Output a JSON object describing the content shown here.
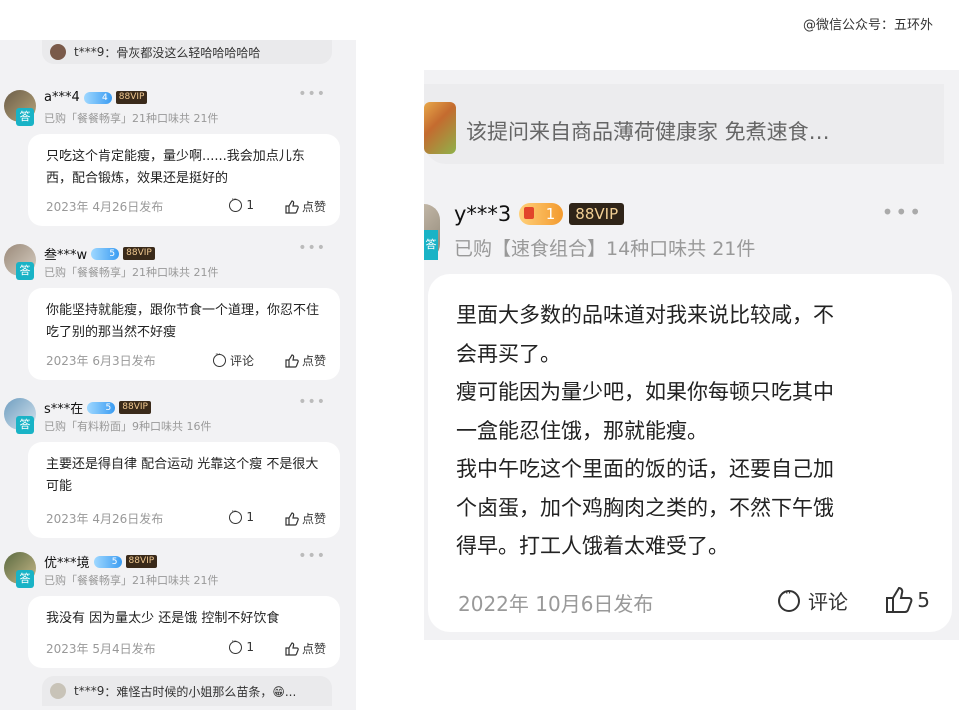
{
  "watermark": "@微信公众号：五环外",
  "left": {
    "top_reply": {
      "user": "t***9",
      "text": "骨灰都没这么轻哈哈哈哈哈"
    },
    "reviews": [
      {
        "user": "a***4",
        "level": "4",
        "vip": "88VIP",
        "answer_badge": "答",
        "bought": "已购「餐餐畅享」21种口味共 21件",
        "text": "只吃这个肯定能瘦，量少啊......我会加点儿东西，配合锻炼，效果还是挺好的",
        "date": "2023年 4月26日发布",
        "comment": "1",
        "like": "点赞"
      },
      {
        "user": "叁***w",
        "level": "5",
        "vip": "88VIP",
        "answer_badge": "答",
        "bought": "已购「餐餐畅享」21种口味共 21件",
        "text": "你能坚持就能瘦，跟你节食一个道理，你忍不住吃了别的那当然不好瘦",
        "date": "2023年 6月3日发布",
        "comment": "评论",
        "like": "点赞"
      },
      {
        "user": "s***在",
        "level": "5",
        "vip": "88VIP",
        "answer_badge": "答",
        "bought": "已购「有料粉面」9种口味共 16件",
        "text": "主要还是得自律 配合运动 光靠这个瘦 不是很大可能",
        "date": "2023年 4月26日发布",
        "comment": "1",
        "like": "点赞"
      },
      {
        "user": "优***境",
        "level": "5",
        "vip": "88VIP",
        "answer_badge": "答",
        "bought": "已购「餐餐畅享」21种口味共 21件",
        "text": "我没有 因为量太少 还是饿 控制不好饮食",
        "date": "2023年 5月4日发布",
        "comment": "1",
        "like": "点赞"
      }
    ],
    "bottom_reply": {
      "user": "t***9",
      "text": "难怪古时候的小姐那么苗条，😁..."
    }
  },
  "right": {
    "from_text": "该提问来自商品薄荷健康家 免煮速食…",
    "review": {
      "user": "y***3",
      "level": "1",
      "vip": "88VIP",
      "answer_badge": "答",
      "bought": "已购【速食组合】14种口味共 21件",
      "lines": [
        "里面大多数的品味道对我来说比较咸，不",
        "会再买了。",
        "瘦可能因为量少吧，如果你每顿只吃其中",
        "一盒能忍住饿，那就能瘦。",
        "我中午吃这个里面的饭的话，还要自己加",
        "个卤蛋，加个鸡胸肉之类的，不然下午饿",
        "得早。打工人饿着太难受了。"
      ],
      "date": "2022年 10月6日发布",
      "comment": "评论",
      "like": "5"
    }
  }
}
